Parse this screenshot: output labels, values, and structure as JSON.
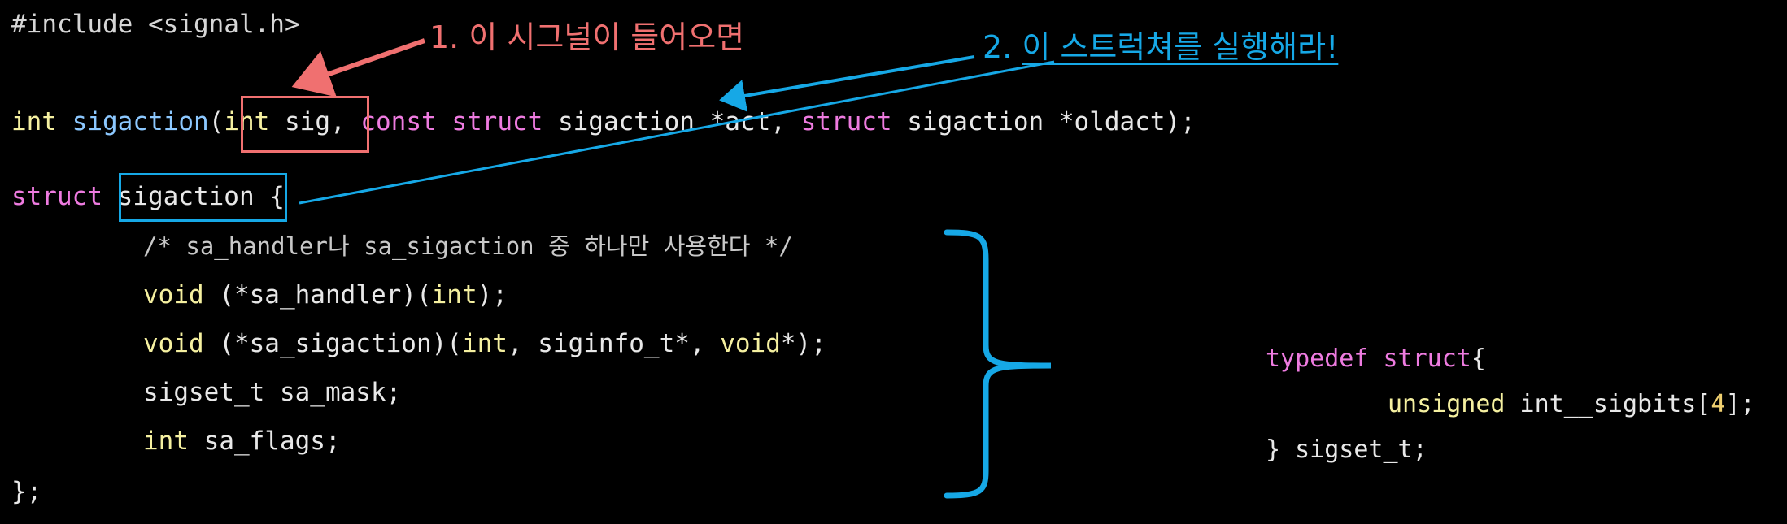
{
  "code": {
    "include": "#include <signal.h>",
    "proto": {
      "ret": "int",
      "name": "sigaction",
      "open": "(",
      "p1_type": "int",
      "p1_name": " sig",
      "comma1": ",",
      "sp1": " ",
      "p2_const": "const",
      "sp2": " ",
      "p2_struct": "struct",
      "p2_rest": " sigaction *act, ",
      "p3_struct": "struct",
      "p3_rest": " sigaction *oldact);"
    },
    "struct_open": {
      "kw": "struct",
      "name": "sigaction",
      "brace": " {"
    },
    "comment": "/* sa_handler나 sa_sigaction 중 하나만 사용한다 */",
    "handler": {
      "kw": "void",
      "rest1": " (*sa_handler)(",
      "int": "int",
      "rest2": ");"
    },
    "sigaction_field": {
      "kw": "void",
      "rest1": " (*sa_sigaction)(",
      "int": "int",
      "rest2": ", siginfo_t*, ",
      "void": "void",
      "rest3": "*);"
    },
    "mask": "sigset_t sa_mask;",
    "flags": {
      "kw": "int",
      "rest": " sa_flags;"
    },
    "close": "};"
  },
  "typedef": {
    "line1_kw": "typedef",
    "line1_kw2": " struct",
    "line1_brace": "{",
    "line2_kw": "unsigned",
    "line2_rest": " int__sigbits[",
    "line2_num": "4",
    "line2_end": "];",
    "line3": "} sigset_t;"
  },
  "annotations": {
    "a1": "1. 이 시그널이 들어오면",
    "a2_prefix": "2. ",
    "a2_text": "이 스트럭쳐를 실행해라!"
  },
  "colors": {
    "red": "#f07070",
    "blue": "#16a8e6"
  }
}
